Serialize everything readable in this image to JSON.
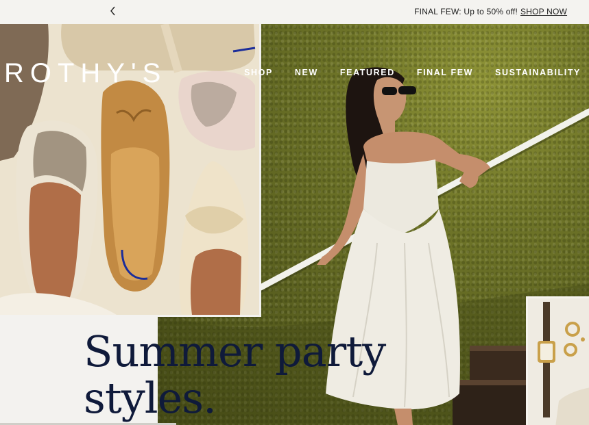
{
  "announcement": {
    "text": "FINAL FEW: Up to 50% off!",
    "link": "SHOP NOW",
    "prev_icon": "chevron-left-icon"
  },
  "brand": {
    "logo": "ROTHY'S"
  },
  "nav": {
    "items": [
      {
        "label": "SHOP"
      },
      {
        "label": "NEW"
      },
      {
        "label": "FEATURED"
      },
      {
        "label": "FINAL FEW"
      },
      {
        "label": "SUSTAINABILITY"
      }
    ]
  },
  "hero": {
    "headline_line1": "Summer party",
    "headline_line2": "styles.",
    "colors": {
      "headline": "#0f1a3a",
      "wall": "#5b6120",
      "background": "#f3f2ef"
    }
  }
}
